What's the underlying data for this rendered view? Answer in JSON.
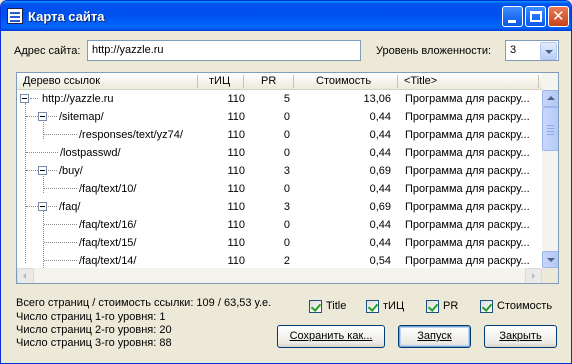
{
  "window": {
    "title": "Карта сайта"
  },
  "form": {
    "address_label": "Адрес сайта:",
    "address_value": "http://yazzle.ru",
    "depth_label": "Уровень вложенности:",
    "depth_value": "3"
  },
  "table": {
    "columns": [
      "Дерево ссылок",
      "тИЦ",
      "PR",
      "Стоимость",
      "<Title>"
    ],
    "rows": [
      {
        "path": "http://yazzle.ru",
        "tic": "110",
        "pr": "5",
        "cost": "13,06",
        "title": "Программа для раскру..."
      },
      {
        "path": "/sitemap/",
        "tic": "110",
        "pr": "0",
        "cost": "0,44",
        "title": "Программа для раскру..."
      },
      {
        "path": "/responses/text/yz74/",
        "tic": "110",
        "pr": "0",
        "cost": "0,44",
        "title": "Программа для раскру..."
      },
      {
        "path": "/lostpasswd/",
        "tic": "110",
        "pr": "0",
        "cost": "0,44",
        "title": "Программа для раскру..."
      },
      {
        "path": "/buy/",
        "tic": "110",
        "pr": "3",
        "cost": "0,69",
        "title": "Программа для раскру..."
      },
      {
        "path": "/faq/text/10/",
        "tic": "110",
        "pr": "0",
        "cost": "0,44",
        "title": "Программа для раскру..."
      },
      {
        "path": "/faq/",
        "tic": "110",
        "pr": "3",
        "cost": "0,69",
        "title": "Программа для раскру..."
      },
      {
        "path": "/faq/text/16/",
        "tic": "110",
        "pr": "0",
        "cost": "0,44",
        "title": "Программа для раскру..."
      },
      {
        "path": "/faq/text/15/",
        "tic": "110",
        "pr": "0",
        "cost": "0,44",
        "title": "Программа для раскру..."
      },
      {
        "path": "/faq/text/14/",
        "tic": "110",
        "pr": "2",
        "cost": "0,54",
        "title": "Программа для раскру..."
      }
    ]
  },
  "stats": {
    "total": "Всего страниц / стоимость ссылки: 109 / 63,53 у.е.",
    "level1": "Число страниц 1-го уровня: 1",
    "level2": "Число страниц 2-го уровня: 20",
    "level3": "Число страниц 3-го уровня: 88"
  },
  "checkboxes": {
    "title": "Title",
    "tic": "тИЦ",
    "pr": "PR",
    "cost": "Стоимость"
  },
  "buttons": {
    "save": "Сохранить как...",
    "run": "Запуск",
    "close": "Закрыть"
  },
  "colors": {
    "titlebar": "#0053ee",
    "window_bg": "#ece9d8",
    "checkmark": "#21a121"
  }
}
